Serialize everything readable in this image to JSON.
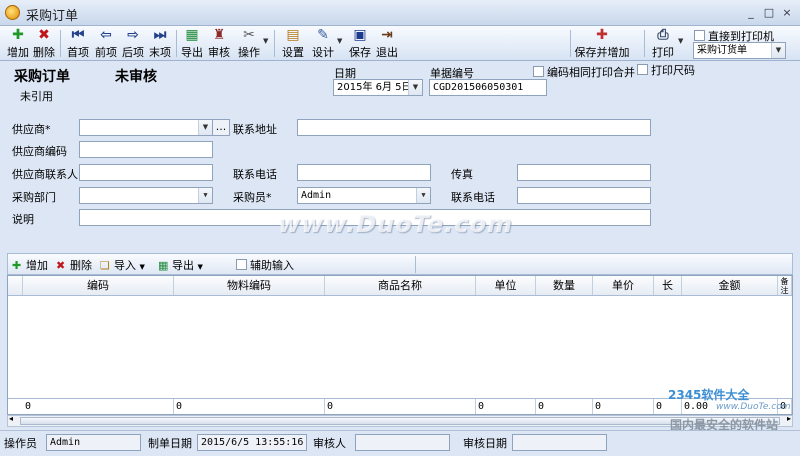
{
  "window": {
    "title": "采购订单",
    "controls": [
      "_",
      "□",
      "×"
    ]
  },
  "toolbar": {
    "buttons": [
      "增加",
      "删除",
      "首项",
      "前项",
      "后项",
      "末项",
      "导出",
      "审核",
      "操作",
      "设置",
      "设计",
      "保存",
      "退出"
    ],
    "save_and_add": "保存并增加",
    "print": "打印",
    "direct_print_label": "直接到打印机",
    "print_template": "采购订货单"
  },
  "header": {
    "doc_title": "采购订单",
    "audit_status": "未审核",
    "ref_status": "未引用",
    "date_label": "日期",
    "date_value": "2015年 6月 5日",
    "docno_label": "单据编号",
    "docno_value": "CGD201506050301",
    "merge_print_label": "编码相同打印合并",
    "print_size_label": "打印尺码",
    "supplier_label": "供应商*",
    "supplier_value": "",
    "address_label": "联系地址",
    "supplier_code_label": "供应商编码",
    "contact_label": "供应商联系人",
    "phone_label": "联系电话",
    "fax_label": "传真",
    "dept_label": "采购部门",
    "buyer_label": "采购员*",
    "buyer_value": "Admin",
    "phone2_label": "联系电话",
    "note_label": "说明"
  },
  "grid_toolbar": {
    "add": "增加",
    "delete": "删除",
    "import": "导入",
    "export": "导出",
    "assist_input": "辅助输入"
  },
  "grid": {
    "columns": [
      "编码",
      "物料编码",
      "商品名称",
      "单位",
      "数量",
      "单价",
      "长",
      "金额",
      "备注"
    ],
    "totals": [
      "0",
      "0",
      "0",
      "0",
      "0",
      "0",
      "0",
      "0.00",
      "0"
    ]
  },
  "status": {
    "operator_label": "操作员",
    "operator_value": "Admin",
    "created_label": "制单日期",
    "created_value": "2015/6/5 13:55:16",
    "auditor_label": "审核人",
    "audit_date_label": "审核日期"
  },
  "watermarks": {
    "duote": "www.DuoTe.com",
    "brand": "2345软件大全",
    "brand_url": "www.DuoTe.com",
    "slogan": "国内最安全的软件站"
  }
}
